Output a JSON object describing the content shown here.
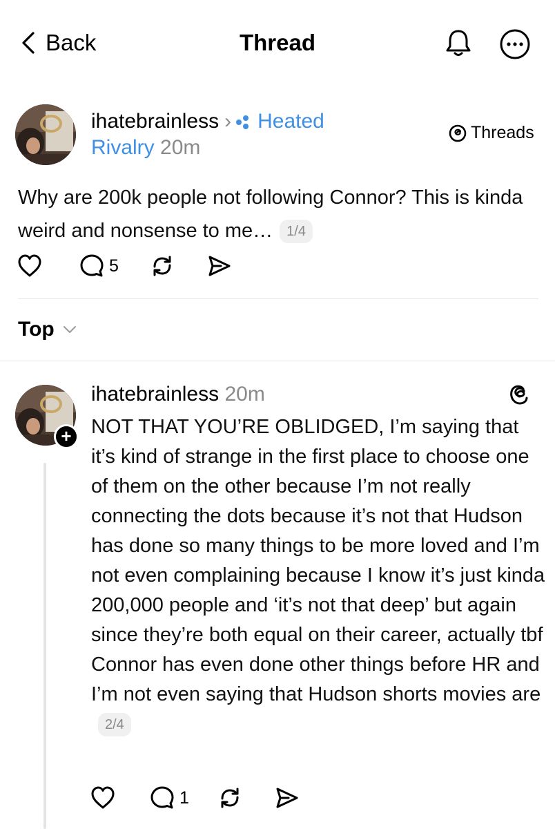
{
  "header": {
    "back_label": "Back",
    "title": "Thread"
  },
  "post": {
    "username": "ihatebrainless",
    "community_part1": "Heated",
    "community_part2": "Rivalry",
    "time": "20m",
    "source_label": "Threads",
    "text": "Why are 200k people not following Connor? This is kinda weird and nonsense to me…",
    "pager": "1/4",
    "reply_count": "5"
  },
  "sort": {
    "label": "Top"
  },
  "reply": {
    "username": "ihatebrainless",
    "time": "20m",
    "text": "NOT THAT YOU’RE OBLIDGED, I’m saying that it’s kind of strange in the first place to choose one of them on the other because I’m not really connecting the dots because it’s not that Hudson has done so many things to be more loved and I’m not even complaining because I know it’s just kinda 200,000 people and ‘it’s not that deep’ but again since they’re both equal on their career, actually tbf Connor has even done other things before HR and I’m not even saying that Hudson shorts movies are",
    "pager": "2/4",
    "reply_count": "1"
  },
  "icons": [
    "chevron-left-icon",
    "bell-icon",
    "more-icon",
    "threads-logo-icon",
    "heart-icon",
    "comment-icon",
    "repost-icon",
    "share-icon",
    "chevron-down-icon",
    "plus-icon"
  ],
  "colors": {
    "link_blue": "#3f8fe4",
    "muted_gray": "#8a8a8a",
    "divider": "#e6e6e6"
  }
}
